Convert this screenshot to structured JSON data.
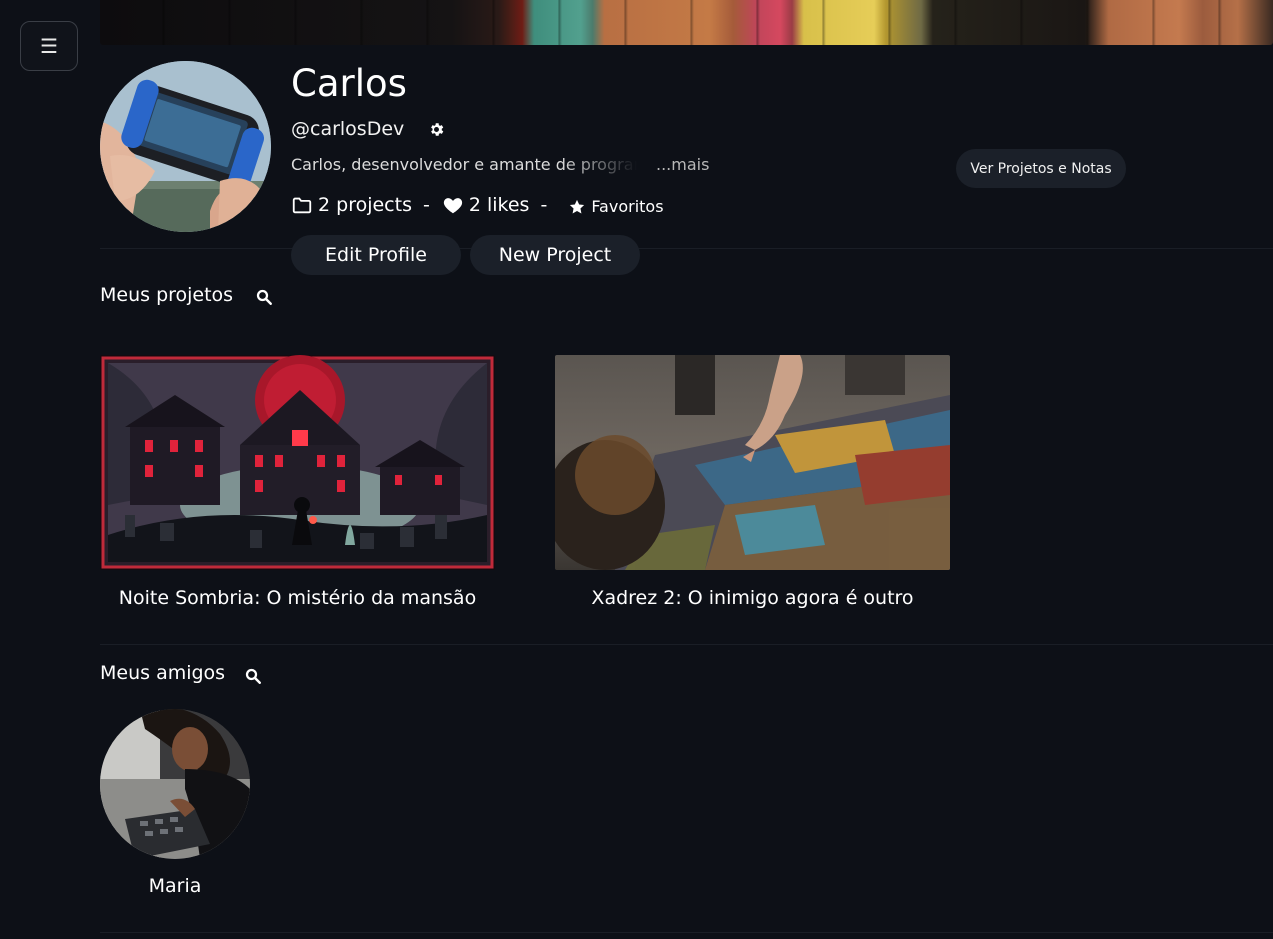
{
  "menu": {
    "icon": "hamburger-icon",
    "label": "☰"
  },
  "profile": {
    "name": "Carlos",
    "handle": "@carlosDev",
    "bio": "Carlos, desenvolvedor e amante de programação",
    "bio_more": "...mais",
    "projects_count": "2 projects",
    "separator": "-",
    "likes_count": "2 likes",
    "favorites_label": "Favoritos"
  },
  "actions": {
    "ver_projetos": "Ver Projetos e Notas",
    "edit_profile": "Edit Profile",
    "new_project": "New Project"
  },
  "projects_section": {
    "title": "Meus projetos",
    "items": [
      {
        "title": "Noite Sombria: O mistério da mansão",
        "image": "haunted-mansion-illustration"
      },
      {
        "title": "Xadrez 2: O inimigo agora é outro",
        "image": "jigsaw-puzzle-photo"
      }
    ]
  },
  "friends_section": {
    "title": "Meus amigos",
    "items": [
      {
        "name": "Maria",
        "image": "woman-working-on-laptop-photo"
      }
    ]
  },
  "colors": {
    "background": "#0d1017",
    "button_bg": "#1b2029",
    "text": "#ffffff"
  }
}
